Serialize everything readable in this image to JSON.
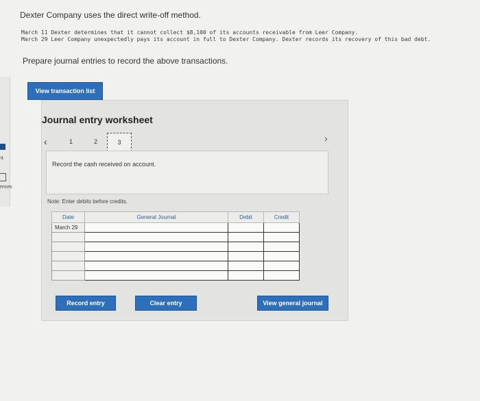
{
  "sidebar": {
    "label_1": "nt",
    "label_2": "ences"
  },
  "problem": {
    "intro": "Dexter Company uses the direct write-off method.",
    "transactions": [
      "March 11 Dexter determines that it cannot collect $8,100 of its accounts receivable from Leer Company.",
      "March 29 Leer Company unexpectedly pays its account in full to Dexter Company. Dexter records its recovery of this bad debt."
    ],
    "prompt": "Prepare journal entries to record the above transactions."
  },
  "buttons": {
    "view_transaction_list": "View transaction list",
    "record_entry": "Record entry",
    "clear_entry": "Clear entry",
    "view_general_journal": "View general journal"
  },
  "worksheet": {
    "title": "Journal entry worksheet",
    "pages": [
      "1",
      "2",
      "3"
    ],
    "current_page": "3",
    "instruction": "Record the cash received on account.",
    "note": "Note: Enter debits before credits.",
    "table": {
      "headers": [
        "Date",
        "General Journal",
        "Debit",
        "Credit"
      ],
      "rows": [
        [
          "March 29",
          "",
          "",
          ""
        ],
        [
          "",
          "",
          "",
          ""
        ],
        [
          "",
          "",
          "",
          ""
        ],
        [
          "",
          "",
          "",
          ""
        ],
        [
          "",
          "",
          "",
          ""
        ],
        [
          "",
          "",
          "",
          ""
        ]
      ]
    }
  },
  "icons": {
    "prev": "chevron-left-icon",
    "next": "chevron-right-icon"
  },
  "colors": {
    "button_blue": "#2d6fba",
    "header_text_blue": "#2f5f9c"
  }
}
